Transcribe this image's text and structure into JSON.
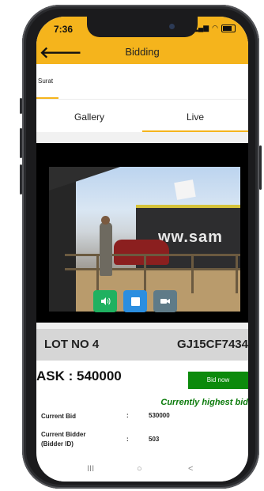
{
  "status_bar": {
    "time": "7:36"
  },
  "app_bar": {
    "title": "Bidding"
  },
  "city": {
    "label": "Surat"
  },
  "tabs": [
    {
      "label": "Gallery"
    },
    {
      "label": "Live"
    }
  ],
  "video": {
    "sign_text": "ww.sam"
  },
  "lot": {
    "number": "LOT NO 4",
    "registration": "GJ15CF7434"
  },
  "ask": {
    "text": "ASK : 540000"
  },
  "bid_button": {
    "label": "Bid now"
  },
  "status_message": "Currently highest bid",
  "details": [
    {
      "label": "Current Bid",
      "colon": ":",
      "value": "530000"
    },
    {
      "label": "Current Bidder (Bidder ID)",
      "colon": ":",
      "value": "503"
    }
  ],
  "nav": {
    "recents": "III",
    "home": "○",
    "back": "<"
  },
  "colors": {
    "accent": "#f5b41c",
    "bid_button": "#0c8a0c",
    "status_text": "#0a7a0a"
  }
}
